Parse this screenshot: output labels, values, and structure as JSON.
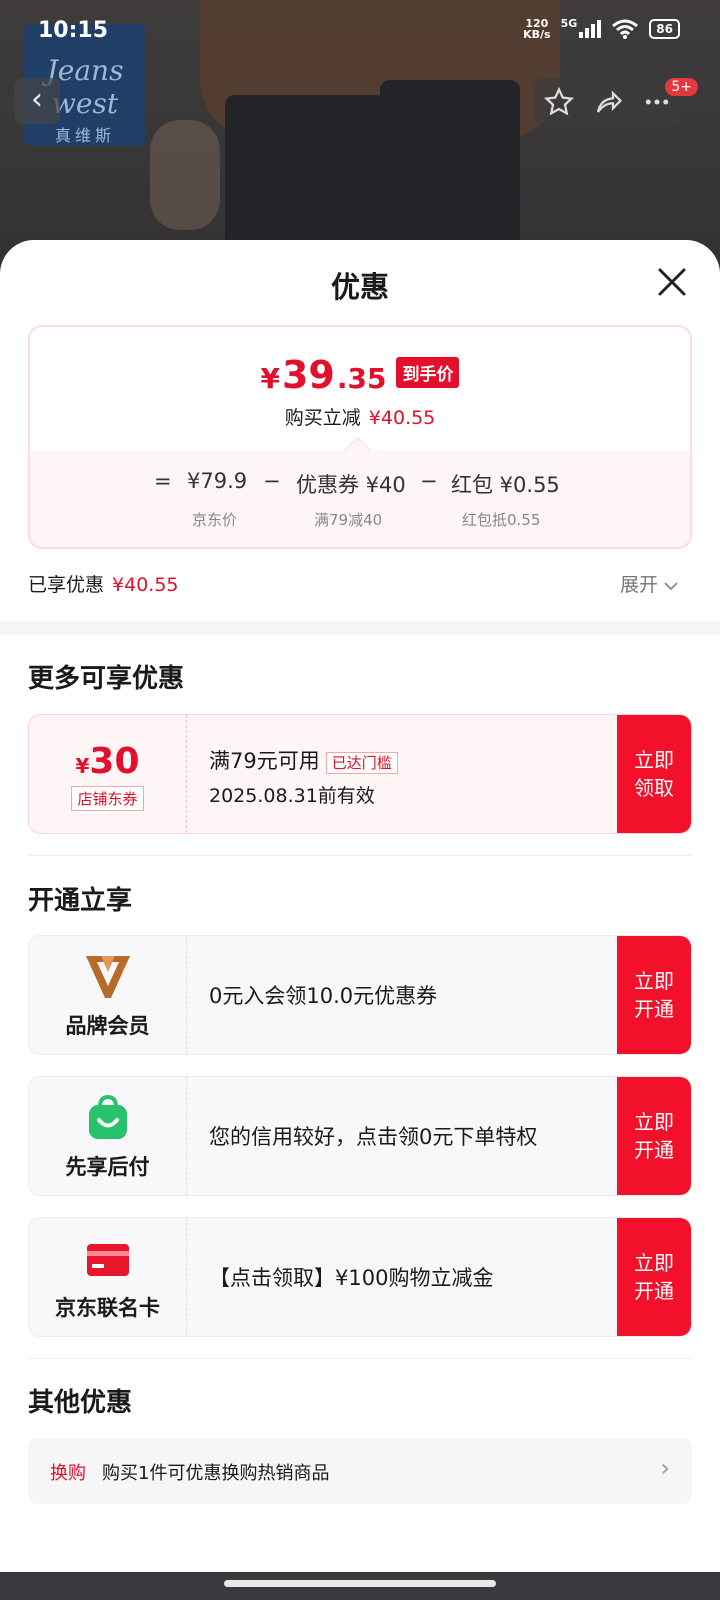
{
  "status_bar": {
    "time": "10:15",
    "speed": "120\nKB/s",
    "speed_top": "120",
    "speed_bottom": "KB/s",
    "network": "5G",
    "battery": "86"
  },
  "brand": {
    "line1": "Jeans west",
    "line2": "真维斯"
  },
  "topbar": {
    "badge": "5+"
  },
  "sheet": {
    "title": "优惠"
  },
  "price": {
    "yen": "¥",
    "integer": "39",
    "decimal": ".35",
    "tag": "到手价",
    "reduce_label": "购买立减",
    "reduce_value": "¥40.55",
    "equals": "=",
    "jd_price": "¥79.9",
    "minus1": "−",
    "coupon_label": "优惠券 ¥40",
    "minus2": "−",
    "redpacket_label": "红包 ¥0.55",
    "jd_price_caption": "京东价",
    "coupon_caption": "满79减40",
    "redpacket_caption": "红包抵0.55"
  },
  "enjoyed": {
    "label": "已享优惠",
    "value": "¥40.55",
    "expand": "展开"
  },
  "more_section": {
    "title": "更多可享优惠",
    "coupon": {
      "yen": "¥",
      "amount": "30",
      "kind": "店铺东券",
      "condition": "满79元可用",
      "reached": "已达门槛",
      "validity": "2025.08.31前有效",
      "button": "立即\n领取",
      "button_l1": "立即",
      "button_l2": "领取"
    }
  },
  "open_section": {
    "title": "开通立享",
    "cards": [
      {
        "icon": "brand-member-v-icon",
        "label": "品牌会员",
        "text": "0元入会领10.0元优惠券",
        "btn_l1": "立即",
        "btn_l2": "开通"
      },
      {
        "icon": "shopping-bag-icon",
        "label": "先享后付",
        "text": "您的信用较好，点击领0元下单特权",
        "btn_l1": "立即",
        "btn_l2": "开通"
      },
      {
        "icon": "credit-card-icon",
        "label": "京东联名卡",
        "text": "【点击领取】¥100购物立减金",
        "btn_l1": "立即",
        "btn_l2": "开通"
      }
    ]
  },
  "other_section": {
    "title": "其他优惠",
    "swap_tag": "换购",
    "swap_text": "购买1件可优惠换购热销商品"
  },
  "colors": {
    "accent_red": "#e4102b",
    "button_red": "#f2102a",
    "brand_blue": "#203f66",
    "green": "#27c26b"
  }
}
